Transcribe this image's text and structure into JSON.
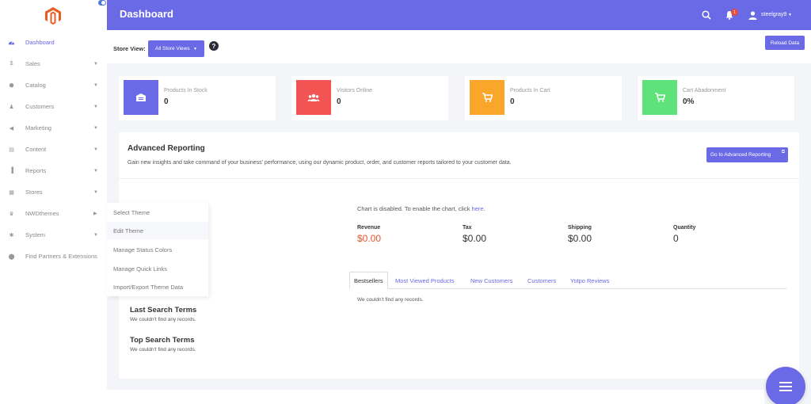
{
  "header": {
    "title": "Dashboard",
    "notification_count": "1",
    "username": "steelgray9"
  },
  "sidebar": {
    "items": [
      {
        "label": "Dashboard",
        "icon": "dashboard-icon",
        "active": true
      },
      {
        "label": "Sales",
        "icon": "dollar-icon"
      },
      {
        "label": "Catalog",
        "icon": "catalog-icon"
      },
      {
        "label": "Customers",
        "icon": "customers-icon"
      },
      {
        "label": "Marketing",
        "icon": "megaphone-icon"
      },
      {
        "label": "Content",
        "icon": "content-icon"
      },
      {
        "label": "Reports",
        "icon": "bar-chart-icon"
      },
      {
        "label": "Stores",
        "icon": "store-icon"
      },
      {
        "label": "NWDthemes",
        "icon": "crown-icon"
      },
      {
        "label": "System",
        "icon": "gear-icon"
      },
      {
        "label": "Find Partners & Extensions",
        "icon": "puzzle-icon"
      }
    ]
  },
  "flyout": {
    "items": [
      {
        "label": "Select Theme"
      },
      {
        "label": "Edit Theme"
      },
      {
        "label": "Manage Status Colors"
      },
      {
        "label": "Manage Quick Links"
      },
      {
        "label": "Import/Export Theme Data"
      }
    ]
  },
  "storebar": {
    "label": "Store View:",
    "selected": "All Store Views",
    "reload": "Reload Data"
  },
  "cards": [
    {
      "title": "Products In Stock",
      "value": "0",
      "color": "#6a6ae6",
      "icon": "inventory-icon"
    },
    {
      "title": "Visitors Online",
      "value": "0",
      "color": "#f25454",
      "icon": "users-icon"
    },
    {
      "title": "Products In Cart",
      "value": "0",
      "color": "#f9a62b",
      "icon": "cart-icon"
    },
    {
      "title": "Cart Abadonment",
      "value": "0%",
      "color": "#5ee37a",
      "icon": "cart-remove-icon"
    }
  ],
  "advanced": {
    "title": "Advanced Reporting",
    "description": "Gain new insights and take command of your business' performance, using our dynamic product, order, and customer reports tailored to your customer data.",
    "button": "Go to Advanced Reporting"
  },
  "chart": {
    "message": "Chart is disabled. To enable the chart, click ",
    "link": "here",
    "message_end": "."
  },
  "metrics": [
    {
      "label": "Revenue",
      "value": "$0.00"
    },
    {
      "label": "Tax",
      "value": "$0.00"
    },
    {
      "label": "Shipping",
      "value": "$0.00"
    },
    {
      "label": "Quantity",
      "value": "0"
    }
  ],
  "tabs": [
    {
      "label": "Bestsellers"
    },
    {
      "label": "Most Viewed Products"
    },
    {
      "label": "New Customers"
    },
    {
      "label": "Customers"
    },
    {
      "label": "Yotpo Reviews"
    }
  ],
  "tab_empty": "We couldn't find any records.",
  "last_search": {
    "title": "Last Search Terms",
    "empty": "We couldn't find any records."
  },
  "top_search": {
    "title": "Top Search Terms",
    "empty": "We couldn't find any records."
  },
  "colors": {
    "accent": "#6a6ae6",
    "revenue": "#e5562a",
    "logo": "#e85d22"
  }
}
